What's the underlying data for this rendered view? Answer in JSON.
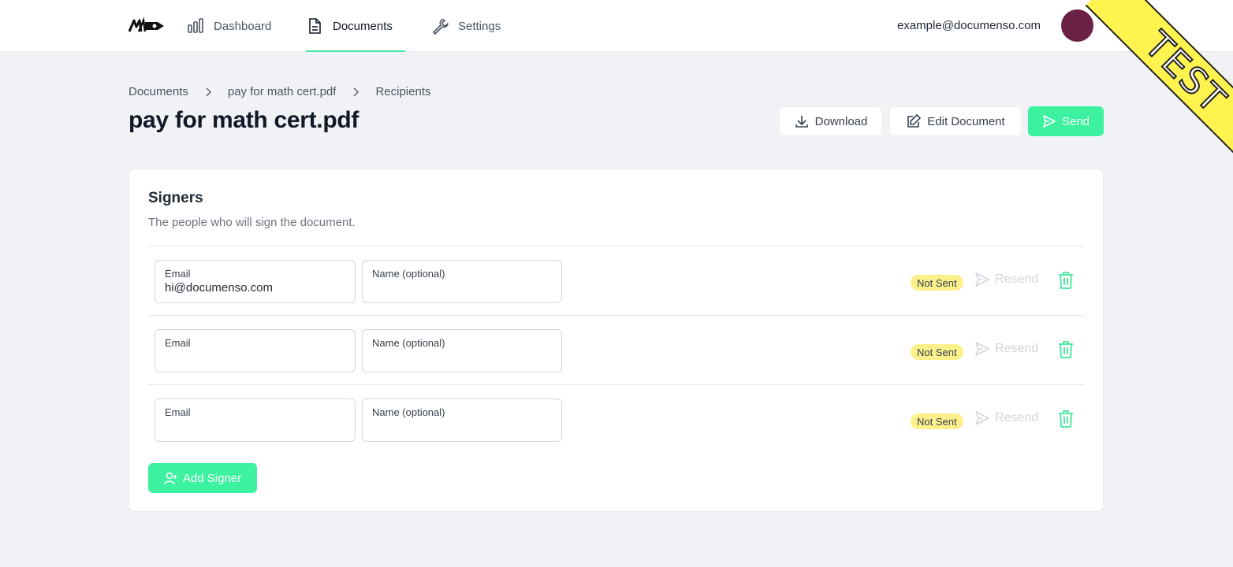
{
  "nav": {
    "items": [
      {
        "label": "Dashboard",
        "icon": "bar-chart-icon"
      },
      {
        "label": "Documents",
        "icon": "document-icon",
        "active": true
      },
      {
        "label": "Settings",
        "icon": "wrench-icon"
      }
    ],
    "user_email": "example@documenso.com"
  },
  "ribbon": {
    "text": "TEST"
  },
  "breadcrumb": [
    "Documents",
    "pay for math cert.pdf",
    "Recipients"
  ],
  "page": {
    "title": "pay for math cert.pdf"
  },
  "actions": {
    "download": "Download",
    "edit": "Edit Document",
    "send": "Send"
  },
  "signers": {
    "title": "Signers",
    "subtitle": "The people who will sign the document.",
    "email_label": "Email",
    "name_label": "Name (optional)",
    "status": "Not Sent",
    "resend": "Resend",
    "rows": [
      {
        "email": "hi@documenso.com",
        "name": ""
      },
      {
        "email": "",
        "name": ""
      },
      {
        "email": "",
        "name": ""
      }
    ],
    "add_button": "Add Signer"
  },
  "colors": {
    "accent": "#3cf2a0",
    "badge": "#fbf08a",
    "avatar": "#6b2145",
    "ribbon": "#fff34f"
  }
}
